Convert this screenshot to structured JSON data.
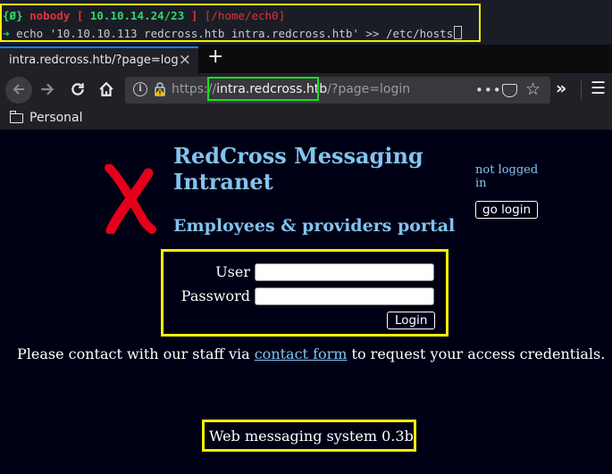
{
  "terminal": {
    "bracket_open": "{",
    "status": "Ø",
    "bracket_close": "}",
    "user": "nobody",
    "bracket2_open": "[",
    "ip": "10.10.14.24/23",
    "bracket2_close": "]",
    "path": "[/home/ech0]",
    "prompt_symbol": "➜",
    "command": "echo '10.10.10.113 redcross.htb intra.redcross.htb' >> /etc/hosts"
  },
  "browser": {
    "tab_title": "intra.redcross.htb/?page=login",
    "tab_close": "×",
    "new_tab": "+",
    "url_prefix": "https://",
    "url_host": "intra.redcross.htb",
    "url_path": "/?page=login",
    "bookmark_folder": "Personal"
  },
  "page": {
    "title": "RedCross Messaging Intranet",
    "subtitle": "Employees & providers portal",
    "status": "not logged in",
    "go_login": "go login",
    "user_label": "User",
    "password_label": "Password",
    "login_button": "Login",
    "contact_before": "Please contact with our staff via ",
    "contact_link": "contact form",
    "contact_after": " to request your access credentials.",
    "footer": "Web messaging system 0.3b"
  },
  "colors": {
    "highlight_yellow": "#f5f100",
    "highlight_green": "#19e01f",
    "title_blue": "#82c4f0",
    "logo_red": "#e5001a"
  }
}
